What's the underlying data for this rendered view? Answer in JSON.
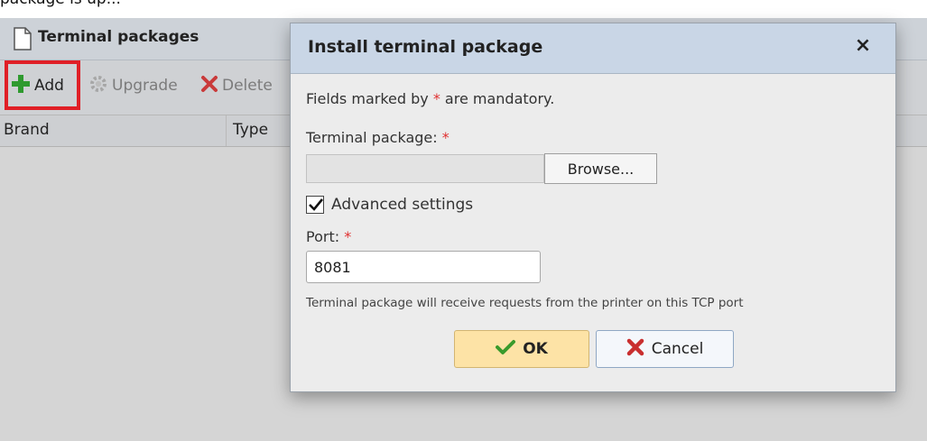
{
  "top_text": "package is up...",
  "colors": {
    "accent_highlight": "#e01f26",
    "ok_button": "#fde3a6",
    "dialog_header": "#c9d6e6"
  },
  "background": {
    "title": "Terminal packages",
    "toolbar": {
      "add": "Add",
      "upgrade": "Upgrade",
      "delete": "Delete"
    },
    "columns": [
      "Brand",
      "Type"
    ]
  },
  "dialog": {
    "title": "Install terminal package",
    "close": "×",
    "mandatory_note": "Fields marked by",
    "mandatory_star": "*",
    "mandatory_suffix": "are mandatory.",
    "package_label": "Terminal package:",
    "package_value": "",
    "browse": "Browse...",
    "advanced_label": "Advanced settings",
    "advanced_checked": true,
    "port_label": "Port:",
    "port_value": "8081",
    "hint": "Terminal package will receive requests from the printer on this TCP port",
    "ok": "OK",
    "cancel": "Cancel"
  }
}
